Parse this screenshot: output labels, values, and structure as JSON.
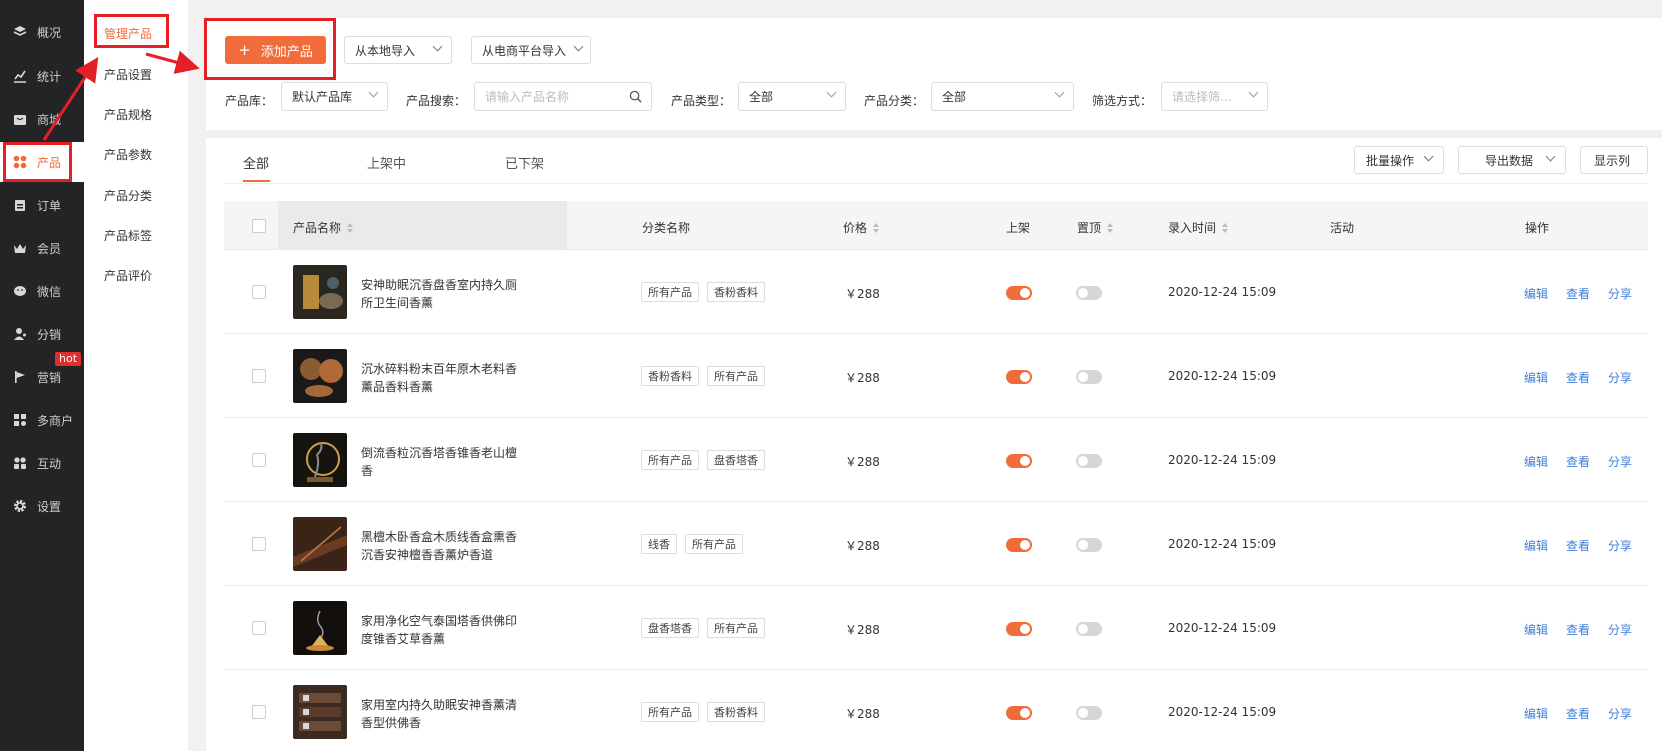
{
  "sidebar": {
    "items": [
      {
        "label": "概况",
        "icon": "layers-icon"
      },
      {
        "label": "统计",
        "icon": "chart-icon"
      },
      {
        "label": "商城",
        "icon": "shop-icon"
      },
      {
        "label": "产品",
        "icon": "grid-icon",
        "active": true
      },
      {
        "label": "订单",
        "icon": "clipboard-icon"
      },
      {
        "label": "会员",
        "icon": "crown-icon"
      },
      {
        "label": "微信",
        "icon": "wechat-icon"
      },
      {
        "label": "分销",
        "icon": "user-share-icon"
      },
      {
        "label": "营销",
        "icon": "flag-icon"
      },
      {
        "label": "多商户",
        "icon": "merchants-icon"
      },
      {
        "label": "互动",
        "icon": "interact-icon"
      },
      {
        "label": "设置",
        "icon": "gear-icon"
      }
    ],
    "hot_badge": "hot"
  },
  "submenu": {
    "items": [
      "管理产品",
      "产品设置",
      "产品规格",
      "产品参数",
      "产品分类",
      "产品标签",
      "产品评价"
    ]
  },
  "toolbar": {
    "add_label": "添加产品",
    "local_import": "从本地导入",
    "ecommerce_import": "从电商平台导入"
  },
  "filters": {
    "library_label": "产品库：",
    "library_value": "默认产品库",
    "search_label": "产品搜索：",
    "search_placeholder": "请输入产品名称",
    "type_label": "产品类型：",
    "type_value": "全部",
    "category_label": "产品分类：",
    "category_value": "全部",
    "filter_label": "筛选方式：",
    "filter_placeholder": "请选择筛..."
  },
  "tabs": [
    "全部",
    "上架中",
    "已下架"
  ],
  "actions": {
    "batch": "批量操作",
    "export": "导出数据",
    "columns": "显示列"
  },
  "table": {
    "headers": {
      "name": "产品名称",
      "category": "分类名称",
      "price": "价格",
      "listed": "上架",
      "pinned": "置顶",
      "time": "录入时间",
      "activity": "活动",
      "ops": "操作"
    },
    "rows": [
      {
        "name": "安神助眠沉香盘香室内持久厕所卫生间香薰",
        "tags": [
          "所有产品",
          "香粉香料"
        ],
        "price": "￥288",
        "listed": true,
        "pinned": false,
        "time": "2020-12-24 15:09"
      },
      {
        "name": "沉水碎料粉末百年原木老料香薰品香料香薰",
        "tags": [
          "香粉香料",
          "所有产品"
        ],
        "price": "￥288",
        "listed": true,
        "pinned": false,
        "time": "2020-12-24 15:09"
      },
      {
        "name": "倒流香粒沉香塔香锥香老山檀香",
        "tags": [
          "所有产品",
          "盘香塔香"
        ],
        "price": "￥288",
        "listed": true,
        "pinned": false,
        "time": "2020-12-24 15:09"
      },
      {
        "name": "黑檀木卧香盒木质线香盒熏香沉香安神檀香香薰炉香道",
        "tags": [
          "线香",
          "所有产品"
        ],
        "price": "￥288",
        "listed": true,
        "pinned": false,
        "time": "2020-12-24 15:09"
      },
      {
        "name": "家用净化空气泰国塔香供佛印度锥香艾草香薰",
        "tags": [
          "盘香塔香",
          "所有产品"
        ],
        "price": "￥288",
        "listed": true,
        "pinned": false,
        "time": "2020-12-24 15:09"
      },
      {
        "name": "家用室内持久助眠安神香薰清香型供佛香",
        "tags": [
          "所有产品",
          "香粉香料"
        ],
        "price": "￥288",
        "listed": true,
        "pinned": false,
        "time": "2020-12-24 15:09"
      }
    ],
    "ops": [
      "编辑",
      "查看",
      "分享"
    ]
  },
  "colors": {
    "accent": "#f26b3a",
    "link": "#3f7fd6",
    "annotation": "#e51f26",
    "sidebar": "#222426"
  }
}
